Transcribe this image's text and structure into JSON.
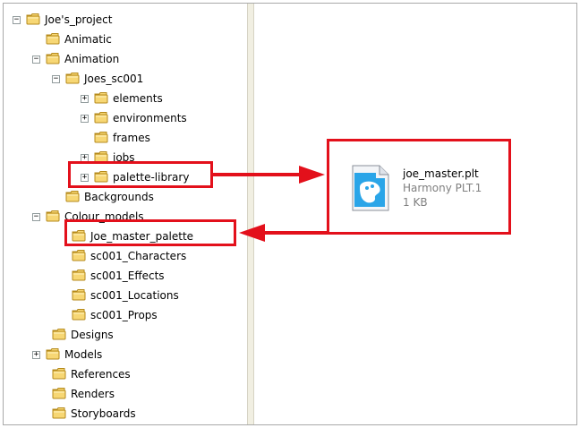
{
  "tree": {
    "items": [
      {
        "label": "Joe's_project",
        "expander": "⊟"
      },
      {
        "label": "Animatic",
        "expander": ""
      },
      {
        "label": "Animation",
        "expander": "⊟"
      },
      {
        "label": "Joes_sc001",
        "expander": "⊟"
      },
      {
        "label": "elements",
        "expander": "⊞"
      },
      {
        "label": "environments",
        "expander": "⊞"
      },
      {
        "label": "frames",
        "expander": ""
      },
      {
        "label": "jobs",
        "expander": "⊞"
      },
      {
        "label": "palette-library",
        "expander": "⊞"
      },
      {
        "label": "Backgrounds",
        "expander": ""
      },
      {
        "label": "Colour_models",
        "expander": "⊟"
      },
      {
        "label": "Joe_master_palette",
        "expander": ""
      },
      {
        "label": "sc001_Characters",
        "expander": ""
      },
      {
        "label": "sc001_Effects",
        "expander": ""
      },
      {
        "label": "sc001_Locations",
        "expander": ""
      },
      {
        "label": "sc001_Props",
        "expander": ""
      },
      {
        "label": "Designs",
        "expander": ""
      },
      {
        "label": "Models",
        "expander": "⊞"
      },
      {
        "label": "References",
        "expander": ""
      },
      {
        "label": "Renders",
        "expander": ""
      },
      {
        "label": "Storyboards",
        "expander": ""
      }
    ]
  },
  "file": {
    "name": "joe_master.plt",
    "type": "Harmony PLT.1",
    "size": "1 KB"
  },
  "colors": {
    "highlight": "#e3101b",
    "folder_fill": "#f7d774",
    "folder_stroke": "#b58a1b"
  },
  "icons": {
    "folder": "folder-icon",
    "file": "palette-file-icon",
    "expand": "plus-box-icon",
    "collapse": "minus-box-icon"
  }
}
